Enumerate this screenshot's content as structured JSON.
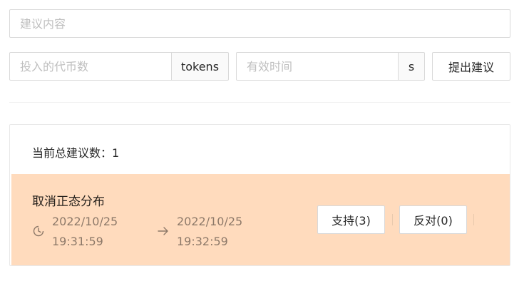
{
  "form": {
    "suggestion_placeholder": "建议内容",
    "tokens_placeholder": "投入的代币数",
    "tokens_unit": "tokens",
    "duration_placeholder": "有效时间",
    "duration_unit": "s",
    "submit_label": "提出建议"
  },
  "list": {
    "count_label": "当前总建议数：1",
    "items": [
      {
        "title": "取消正态分布",
        "start_date": "2022/10/25",
        "start_time": "19:31:59",
        "end_date": "2022/10/25",
        "end_time": "19:32:59",
        "support_label": "支持(3)",
        "oppose_label": "反对(0)",
        "background": "#ffdbbd"
      }
    ]
  },
  "icons": {
    "time": "clock-icon",
    "range": "arrow-right-icon"
  }
}
